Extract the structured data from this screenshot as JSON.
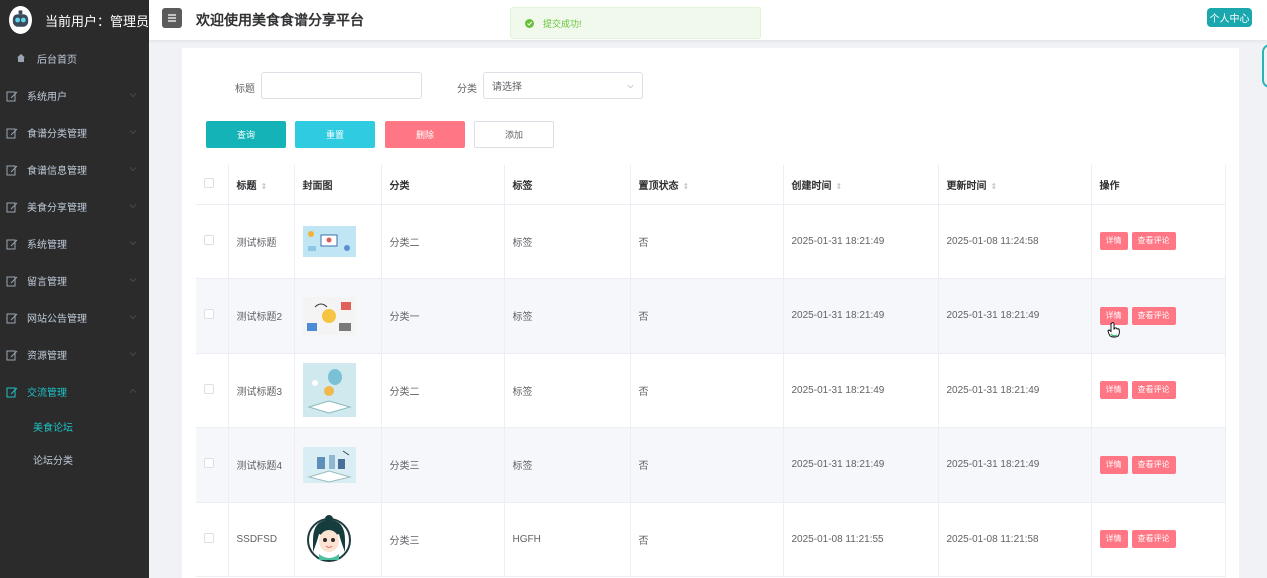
{
  "header": {
    "user_label": "当前用户：管理员",
    "title": "欢迎使用美食食谱分享平台",
    "toast": "提交成功!",
    "personal_center": "个人中心"
  },
  "sidebar": {
    "home": "后台首页",
    "items": [
      {
        "label": "系统用户"
      },
      {
        "label": "食谱分类管理"
      },
      {
        "label": "食谱信息管理"
      },
      {
        "label": "美食分享管理"
      },
      {
        "label": "系统管理"
      },
      {
        "label": "留言管理"
      },
      {
        "label": "网站公告管理"
      },
      {
        "label": "资源管理"
      },
      {
        "label": "交流管理"
      }
    ],
    "sub_items": [
      {
        "label": "美食论坛"
      },
      {
        "label": "论坛分类"
      }
    ]
  },
  "filters": {
    "title_label": "标题",
    "title_value": "",
    "category_label": "分类",
    "category_placeholder": "请选择"
  },
  "buttons": {
    "query": "查询",
    "reset": "重置",
    "delete": "删除",
    "add": "添加"
  },
  "table": {
    "headers": {
      "title": "标题",
      "cover": "封面图",
      "category": "分类",
      "tag": "标签",
      "pinned": "置顶状态",
      "created": "创建时间",
      "updated": "更新时间",
      "ops": "操作"
    },
    "rows": [
      {
        "title": "测试标题",
        "category": "分类二",
        "tag": "标签",
        "pinned": "否",
        "created": "2025-01-31 18:21:49",
        "updated": "2025-01-08 11:24:58",
        "detail": "详情",
        "comments": "查看评论"
      },
      {
        "title": "测试标题2",
        "category": "分类一",
        "tag": "标签",
        "pinned": "否",
        "created": "2025-01-31 18:21:49",
        "updated": "2025-01-31 18:21:49",
        "detail": "详情",
        "comments": "查看评论"
      },
      {
        "title": "测试标题3",
        "category": "分类二",
        "tag": "标签",
        "pinned": "否",
        "created": "2025-01-31 18:21:49",
        "updated": "2025-01-31 18:21:49",
        "detail": "详情",
        "comments": "查看评论"
      },
      {
        "title": "测试标题4",
        "category": "分类三",
        "tag": "标签",
        "pinned": "否",
        "created": "2025-01-31 18:21:49",
        "updated": "2025-01-31 18:21:49",
        "detail": "详情",
        "comments": "查看评论"
      },
      {
        "title": "SSDFSD",
        "category": "分类三",
        "tag": "HGFH",
        "pinned": "否",
        "created": "2025-01-08 11:21:55",
        "updated": "2025-01-08 11:21:58",
        "detail": "详情",
        "comments": "查看评论"
      }
    ]
  },
  "colors": {
    "sidebar_bg": "#2b2b2b",
    "accent": "#1aa7ad",
    "danger": "#ff7785",
    "success": "#67c23a"
  }
}
